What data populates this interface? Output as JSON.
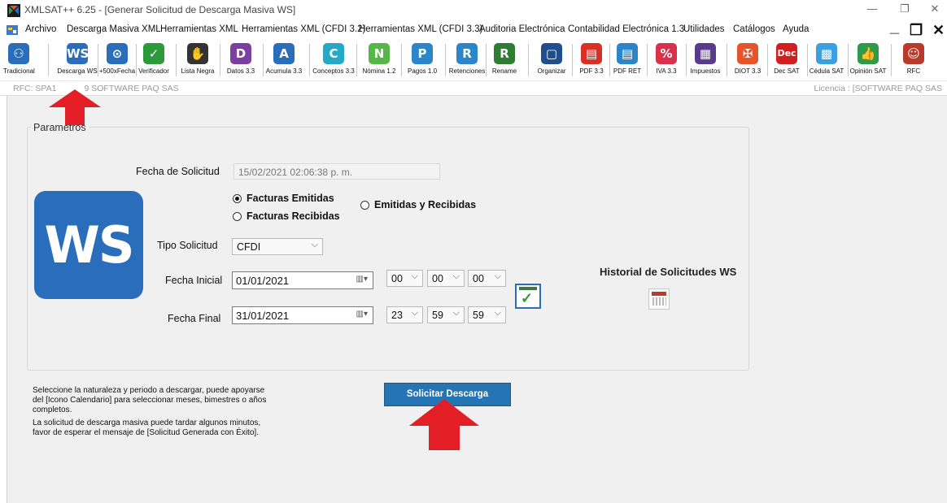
{
  "window": {
    "title": "XMLSAT++ 6.25 - [Generar Solicitud de Descarga Masiva WS]",
    "minimize_icon": "—",
    "restore_icon": "❐",
    "close_icon": "✕"
  },
  "menu": {
    "items": [
      "Archivo",
      "Descarga Masiva XML",
      "Herramientas XML",
      "Herramientas XML (CFDI 3.2)",
      "Herramientas XML (CFDI 3.3)",
      "Auditoria Electrónica",
      "Contabilidad Electrónica 1.3",
      "Utilidades",
      "Catálogos",
      "Ayuda"
    ],
    "mdi_minimize": "_",
    "mdi_restore": "❐",
    "mdi_close": "✕"
  },
  "toolbar": {
    "items": [
      {
        "label": "Tradicional",
        "glyph": "⚇",
        "color": "#2a6ebb",
        "icon": "grid-icon"
      },
      {
        "label": "Descarga WS",
        "glyph": "WS",
        "color": "#2a6ebb",
        "icon": "ws-icon"
      },
      {
        "label": "+500xFecha",
        "glyph": "⊙",
        "color": "#2a6ebb",
        "icon": "cloud-icon"
      },
      {
        "label": "Verificador",
        "glyph": "✓",
        "color": "#2c9a3a",
        "icon": "check-icon"
      },
      {
        "label": "Lista Negra",
        "glyph": "✋",
        "color": "#333333",
        "icon": "hand-icon"
      },
      {
        "label": "Datos 3.3",
        "glyph": "D",
        "color": "#7b3fa0",
        "icon": "datos-icon"
      },
      {
        "label": "Acumula 3.3",
        "glyph": "A",
        "color": "#2a6ebb",
        "icon": "acumula-icon"
      },
      {
        "label": "Conceptos 3.3",
        "glyph": "C",
        "color": "#26a9c6",
        "icon": "conceptos-icon"
      },
      {
        "label": "Nómina 1.2",
        "glyph": "N",
        "color": "#57b64a",
        "icon": "nomina-icon"
      },
      {
        "label": "Pagos 1.0",
        "glyph": "P",
        "color": "#2a86c8",
        "icon": "pagos-icon"
      },
      {
        "label": "Retenciones",
        "glyph": "R",
        "color": "#2a86c8",
        "icon": "retenciones-icon"
      },
      {
        "label": "Rename",
        "glyph": "R",
        "color": "#2e7d32",
        "icon": "rename-icon"
      },
      {
        "label": "Organizar",
        "glyph": "▢",
        "color": "#1f4e8c",
        "icon": "folder-icon"
      },
      {
        "label": "PDF 3.3",
        "glyph": "▤",
        "color": "#d93025",
        "icon": "pdf-icon"
      },
      {
        "label": "PDF RET",
        "glyph": "▤",
        "color": "#2a86c8",
        "icon": "pdf-ret-icon"
      },
      {
        "label": "IVA 3.3",
        "glyph": "%",
        "color": "#d9304c",
        "icon": "percent-icon"
      },
      {
        "label": "Impuestos",
        "glyph": "▦",
        "color": "#5a3a8a",
        "icon": "calculator-icon"
      },
      {
        "label": "DIOT 3.3",
        "glyph": "✠",
        "color": "#e8542a",
        "icon": "handshake-icon"
      },
      {
        "label": "Dec SAT",
        "glyph": "Dec",
        "color": "#d11f1f",
        "icon": "dec-icon"
      },
      {
        "label": "Cédula SAT",
        "glyph": "▩",
        "color": "#3aa0e0",
        "icon": "qr-icon"
      },
      {
        "label": "Opinión SAT",
        "glyph": "👍",
        "color": "#2e9a4a",
        "icon": "thumbs-up-icon"
      },
      {
        "label": "RFC",
        "glyph": "☺",
        "color": "#b83a2a",
        "icon": "person-icon"
      }
    ]
  },
  "status": {
    "rfc": "RFC: SPA1",
    "rfc_company": "9 SOFTWARE PAQ SAS",
    "license": "Licencia : [SOFTWARE PAQ SAS"
  },
  "form": {
    "group_title": "Parametros",
    "logo_text": "WS",
    "fecha_solicitud_label": "Fecha de Solicitud",
    "fecha_solicitud_value": "15/02/2021 02:06:38 p. m.",
    "radio_emitidas": "Facturas Emitidas",
    "radio_recibidas": "Facturas Recibidas",
    "radio_ambas": "Emitidas y Recibidas",
    "tipo_label": "Tipo Solicitud",
    "tipo_value": "CFDI",
    "fecha_inicial_label": "Fecha Inicial",
    "fecha_inicial_value": "01/01/2021",
    "fecha_final_label": "Fecha Final",
    "fecha_final_value": "31/01/2021",
    "ini_h": "00",
    "ini_m": "00",
    "ini_s": "00",
    "fin_h": "23",
    "fin_m": "59",
    "fin_s": "59",
    "historial_label": "Historial de Solicitudes WS",
    "help_lines": [
      "Seleccione la naturaleza y periodo a descargar, puede apoyarse",
      "del [Icono Calendario] para seleccionar meses, bimestres o años",
      "completos.",
      "La solicitud de descarga masiva puede tardar algunos minutos,",
      "favor de esperar el mensaje de [Solicitud Generada con Éxito]."
    ],
    "submit_label": "Solicitar  Descarga"
  },
  "colors": {
    "accent": "#2575b4",
    "annotation_arrow": "#e41e26"
  }
}
